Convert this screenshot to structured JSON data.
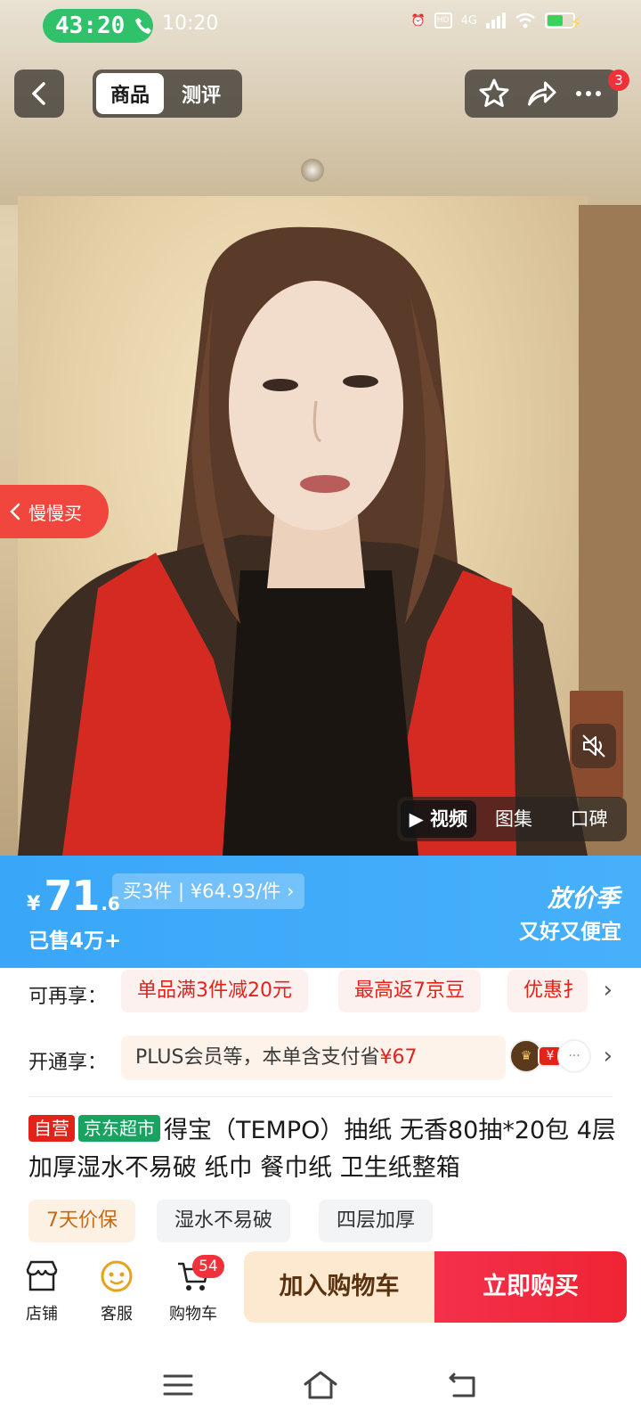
{
  "status_bar": {
    "call_timer": "43:20",
    "time": "10:20",
    "network": "4G"
  },
  "header": {
    "tabs": [
      {
        "label": "商品",
        "active": true
      },
      {
        "label": "测评",
        "active": false
      }
    ],
    "notification_count": "3"
  },
  "hero": {
    "slow_buy_label": "慢慢买",
    "media_tabs": [
      {
        "label": "▶ 视频",
        "active": true
      },
      {
        "label": "图集",
        "active": false
      },
      {
        "label": "口碑",
        "active": false
      }
    ]
  },
  "price": {
    "currency": "¥",
    "integer": "71",
    "decimal": ".6",
    "multi_buy": "买3件 | ¥64.93/件 ›",
    "sold": "已售4万+",
    "promo_title": "放价季",
    "promo_sub": "又好又便宜"
  },
  "benefits": {
    "extra_label": "可再享：",
    "extra_chips": [
      "单品满3件减20元",
      "最高返7京豆",
      "优惠扌"
    ],
    "open_label": "开通享：",
    "plus_text": "PLUS会员等，本单含支付省",
    "plus_amount": "¥67"
  },
  "product": {
    "tag_self": "自营",
    "tag_store": "京东超市",
    "title": "得宝（TEMPO）抽纸 无香80抽*20包 4层加厚湿水不易破 纸巾 餐巾纸 卫生纸整箱",
    "features": [
      "7天价保",
      "湿水不易破",
      "四层加厚"
    ]
  },
  "bottom_bar": {
    "store_label": "店铺",
    "service_label": "客服",
    "cart_label": "购物车",
    "cart_count": "54",
    "add_to_cart": "加入购物车",
    "buy_now": "立即购买"
  },
  "colors": {
    "price_banner": "#3aa6f7",
    "buy_red": "#ef2434",
    "accent_red": "#e2231a",
    "call_green": "#2fc26a"
  }
}
